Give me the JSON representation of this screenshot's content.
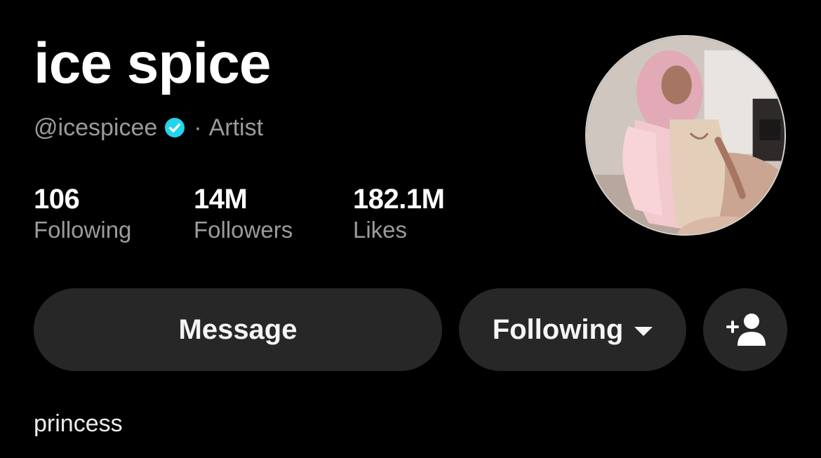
{
  "profile": {
    "display_name": "ice spice",
    "handle": "@icespicee",
    "separator": "·",
    "category": "Artist",
    "verified_icon": "verified-check-icon",
    "avatar_icon": "profile-photo"
  },
  "stats": [
    {
      "value": "106",
      "label": "Following"
    },
    {
      "value": "14M",
      "label": "Followers"
    },
    {
      "value": "182.1M",
      "label": "Likes"
    }
  ],
  "actions": {
    "message_label": "Message",
    "following_label": "Following",
    "following_icon": "caret-down-icon",
    "add_friend_icon": "add-user-icon"
  },
  "bio": "princess",
  "colors": {
    "background": "#000000",
    "button_bg": "#272727",
    "secondary_text": "#9b9b9b",
    "verified_blue": "#20d5ec"
  }
}
